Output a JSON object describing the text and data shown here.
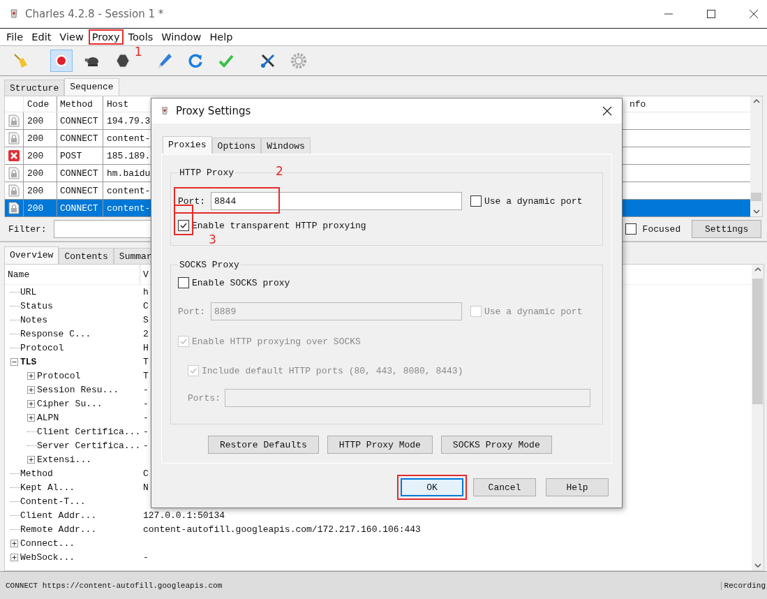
{
  "window": {
    "title": "Charles 4.2.8 - Session 1 *"
  },
  "menu": [
    {
      "label": "File",
      "highlighted": false
    },
    {
      "label": "Edit",
      "highlighted": false
    },
    {
      "label": "View",
      "highlighted": false
    },
    {
      "label": "Proxy",
      "highlighted": true,
      "callout": "1"
    },
    {
      "label": "Tools",
      "highlighted": false
    },
    {
      "label": "Window",
      "highlighted": false
    },
    {
      "label": "Help",
      "highlighted": false
    }
  ],
  "toolbar": [
    {
      "kind": "broom",
      "active": false
    },
    {
      "kind": "record",
      "active": true
    },
    {
      "kind": "turtle",
      "active": false
    },
    {
      "kind": "stop",
      "active": false
    },
    {
      "kind": "pen",
      "active": false
    },
    {
      "kind": "refresh",
      "active": false
    },
    {
      "kind": "check",
      "active": false
    },
    {
      "kind": "tools",
      "active": false
    },
    {
      "kind": "gear",
      "active": false
    }
  ],
  "view_tabs": [
    {
      "label": "Structure",
      "selected": false
    },
    {
      "label": "Sequence",
      "selected": true
    }
  ],
  "table": {
    "columns": [
      "Code",
      "Method",
      "Host",
      "nfo"
    ],
    "rows": [
      {
        "kind": "lock",
        "code": "200",
        "method": "CONNECT",
        "host": "194.79.3",
        "selected": false
      },
      {
        "kind": "lock",
        "code": "200",
        "method": "CONNECT",
        "host": "content-",
        "selected": false
      },
      {
        "kind": "error",
        "code": "200",
        "method": "POST",
        "host": "185.189.",
        "selected": false
      },
      {
        "kind": "lock",
        "code": "200",
        "method": "CONNECT",
        "host": "hm.baidu",
        "selected": false
      },
      {
        "kind": "lock",
        "code": "200",
        "method": "CONNECT",
        "host": "content-",
        "selected": false
      },
      {
        "kind": "lock",
        "code": "200",
        "method": "CONNECT",
        "host": "content-",
        "selected": true
      }
    ]
  },
  "filter": {
    "label": "Filter:",
    "focused_label": "Focused",
    "focused_checked": false,
    "settings_button": "Settings"
  },
  "detail_tabs": [
    {
      "label": "Overview",
      "selected": true
    },
    {
      "label": "Contents",
      "selected": false
    },
    {
      "label": "Summar",
      "selected": false
    }
  ],
  "tree": {
    "columns": [
      "Name",
      "V"
    ],
    "items": [
      {
        "name": "URL",
        "value": "h"
      },
      {
        "name": "Status",
        "value": "C"
      },
      {
        "name": "Notes",
        "value": "S"
      },
      {
        "name": "Response C...",
        "value": "2"
      },
      {
        "name": "Protocol",
        "value": "H"
      },
      {
        "name": "TLS",
        "value": "T",
        "expanded": true,
        "children": [
          {
            "name": "Protocol",
            "value": "T",
            "expanded": false
          },
          {
            "name": "Session Resu...",
            "value": "-",
            "expanded": false
          },
          {
            "name": "Cipher Su...",
            "value": "-",
            "expanded": false
          },
          {
            "name": "ALPN",
            "value": "-",
            "expanded": false
          },
          {
            "name": "Client Certifica...",
            "value": "-"
          },
          {
            "name": "Server Certifica...",
            "value": "-"
          },
          {
            "name": "Extensi...",
            "expanded": false
          }
        ]
      },
      {
        "name": "Method",
        "value": "C"
      },
      {
        "name": "Kept Al...",
        "value": "N"
      },
      {
        "name": "Content-T..."
      },
      {
        "name": "Client Addr...",
        "value": "127.0.0.1:50134"
      },
      {
        "name": "Remote Addr...",
        "value": "content-autofill.googleapis.com/172.217.160.106:443"
      },
      {
        "name": "Connect...",
        "expanded": false
      },
      {
        "name": "WebSock...",
        "value": "-",
        "expanded": false
      }
    ]
  },
  "status_bar": {
    "text": "CONNECT https://content-autofill.googleapis.com",
    "recording": "Recording"
  },
  "dialog": {
    "title": "Proxy Settings",
    "tabs": [
      {
        "label": "Proxies",
        "selected": true
      },
      {
        "label": "Options",
        "selected": false
      },
      {
        "label": "Windows",
        "selected": false
      }
    ],
    "http_proxy": {
      "title": "HTTP Proxy",
      "port_label": "Port:",
      "port": "8844",
      "port_highlighted": true,
      "port_callout": "2",
      "dynamic_label": "Use a dynamic port",
      "dynamic_checked": false,
      "transparent_label": "Enable transparent HTTP proxying",
      "transparent_checked": true,
      "transparent_highlighted": true,
      "transparent_callout": "3"
    },
    "socks_proxy": {
      "title": "SOCKS Proxy",
      "enable_label": "Enable SOCKS proxy",
      "enable_checked": false,
      "port_label": "Port:",
      "port": "8889",
      "dynamic_label": "Use a dynamic port",
      "dynamic_checked": false,
      "over_socks_label": "Enable HTTP proxying over SOCKS",
      "over_socks_checked": true,
      "include_label": "Include default HTTP ports (80, 443, 8080, 8443)",
      "include_checked": true,
      "ports_label": "Ports:",
      "disabled": true
    },
    "mode_buttons": [
      "Restore Defaults",
      "HTTP Proxy Mode",
      "SOCKS Proxy Mode"
    ],
    "buttons": [
      {
        "label": "OK",
        "default": true,
        "highlighted": true
      },
      {
        "label": "Cancel",
        "default": false
      },
      {
        "label": "Help",
        "default": false
      }
    ]
  }
}
